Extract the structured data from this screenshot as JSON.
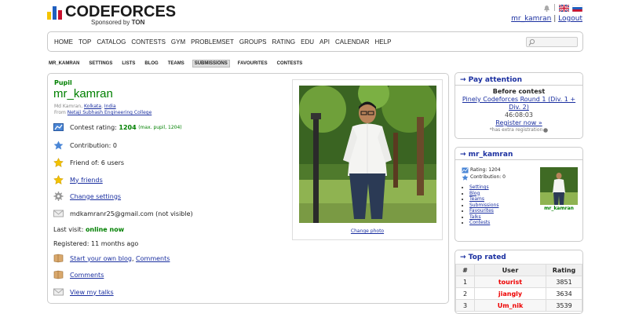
{
  "header": {
    "logo_text": "CODEFORCES",
    "sponsor_prefix": "Sponsored by",
    "sponsor_name": "TON",
    "user_handle_link": "mr_kamran",
    "separator": "|",
    "logout": "Logout"
  },
  "menu": [
    "HOME",
    "TOP",
    "CATALOG",
    "CONTESTS",
    "GYM",
    "PROBLEMSET",
    "GROUPS",
    "RATING",
    "EDU",
    "API",
    "CALENDAR",
    "HELP"
  ],
  "submenu": [
    "MR_KAMRAN",
    "SETTINGS",
    "LISTS",
    "BLOG",
    "TEAMS",
    "SUBMISSIONS",
    "FAVOURITES",
    "CONTESTS"
  ],
  "submenu_active": "SUBMISSIONS",
  "profile": {
    "rank": "Pupil",
    "handle": "mr_kamran",
    "name_prefix": "Md Kamran,",
    "city": "Kolkata",
    "country": "India",
    "from_label": "From",
    "organization": "Netaji Subhash Engineering College",
    "contest_rating_label": "Contest rating:",
    "contest_rating": "1204",
    "max_rating": "(max. pupil, 1204)",
    "contribution": "Contribution: 0",
    "friend_of": "Friend of: 6 users",
    "my_friends": "My friends",
    "change_settings": "Change settings",
    "email": "mdkamranr25@gmail.com (not visible)",
    "last_visit_label": "Last visit:",
    "last_visit": "online now",
    "registered": "Registered: 11 months ago",
    "start_blog": "Start your own blog",
    "comma": ",",
    "comments_link": "Comments",
    "comments": "Comments",
    "view_talks": "View my talks",
    "change_photo": "Change photo"
  },
  "pay_attention": {
    "title": "→ Pay attention",
    "before_contest": "Before contest",
    "contest_name": "Pinely Codeforces Round 1 (Div. 1 + Div. 2)",
    "countdown": "46:08:03",
    "register": "Register now »",
    "extra": "*has extra registration"
  },
  "user_box": {
    "title": "→ mr_kamran",
    "rating": "Rating: 1204",
    "contribution": "Contribution: 0",
    "links": [
      "Settings",
      "Blog",
      "Teams",
      "Submissions",
      "Favourites",
      "Talks",
      "Contests"
    ],
    "avatar_name": "mr_kamran"
  },
  "top_rated": {
    "title": "→ Top rated",
    "headers": [
      "#",
      "User",
      "Rating"
    ],
    "rows": [
      {
        "rank": "1",
        "user": "tourist",
        "rating": "3851"
      },
      {
        "rank": "2",
        "user": "jiangly",
        "rating": "3634"
      },
      {
        "rank": "3",
        "user": "Um_nik",
        "rating": "3539"
      }
    ]
  },
  "colors": {
    "link": "#1a2fa0",
    "pupil": "#008000",
    "red": "#e00000"
  }
}
